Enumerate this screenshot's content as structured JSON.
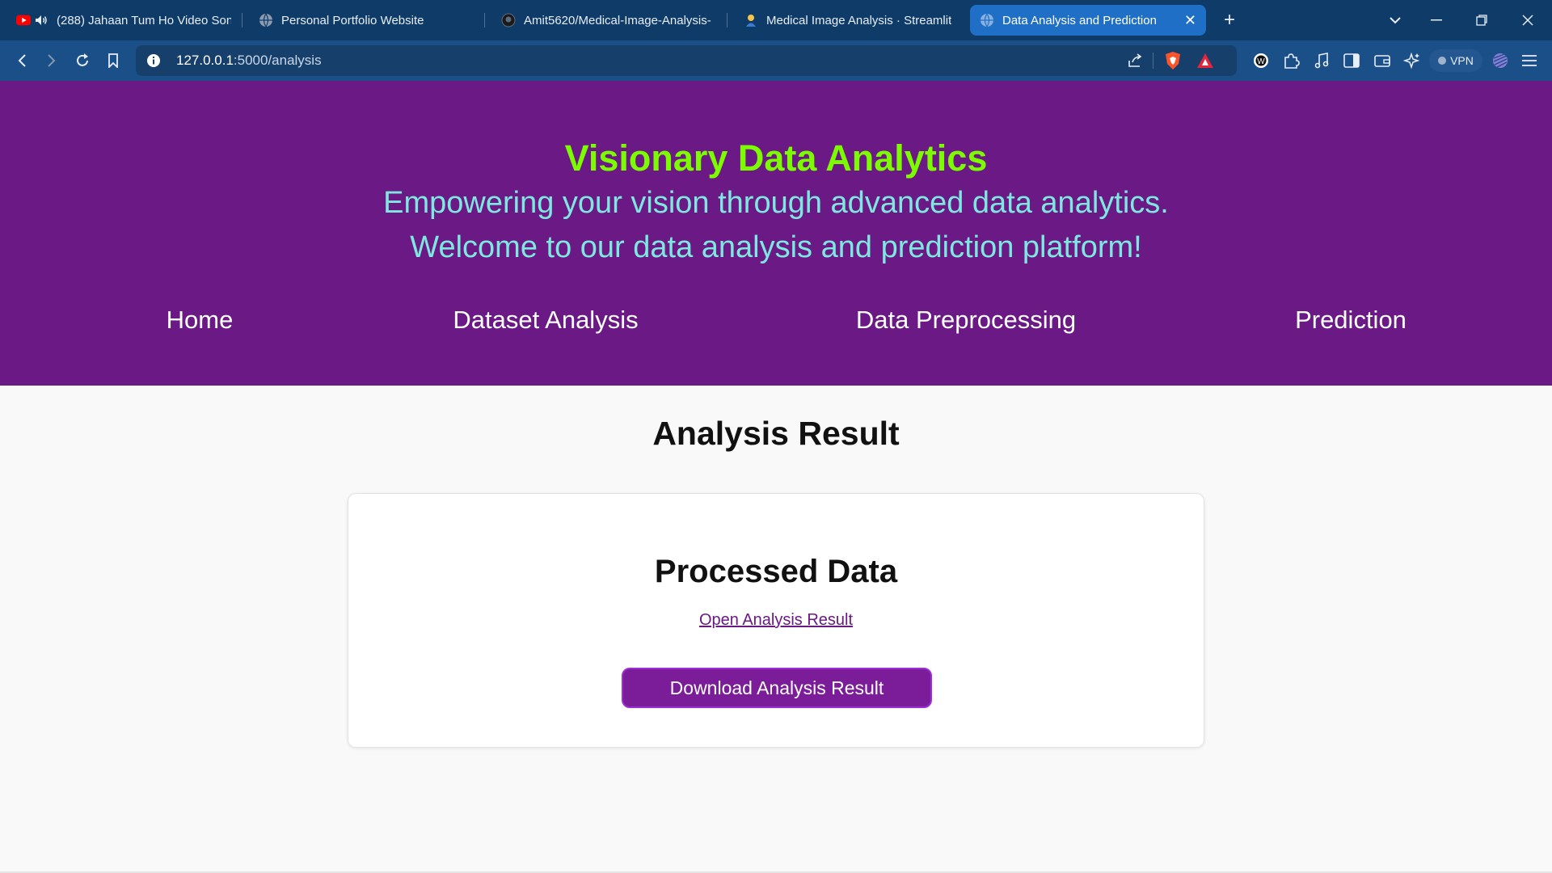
{
  "browser": {
    "tabs": [
      {
        "label": "(288) Jahaan Tum Ho Video Son",
        "icon": "youtube-icon"
      },
      {
        "label": "Personal Portfolio Website",
        "icon": "globe-icon"
      },
      {
        "label": "Amit5620/Medical-Image-Analysis-",
        "icon": "github-icon"
      },
      {
        "label": "Medical Image Analysis · Streamlit",
        "icon": "streamlit-icon"
      },
      {
        "label": "Data Analysis and Prediction",
        "icon": "globe-icon",
        "active": true
      }
    ],
    "url_host": "127.0.0.1",
    "url_path": ":5000/analysis",
    "vpn_label": "VPN",
    "colors": {
      "tabstrip": "#0f3b68",
      "toolbar": "#1b4f87",
      "active_tab": "#1f6fc7"
    }
  },
  "header": {
    "title": "Visionary Data Analytics",
    "subtitle": "Empowering your vision through advanced data analytics.",
    "welcome": "Welcome to our data analysis and prediction platform!",
    "nav": [
      "Home",
      "Dataset Analysis",
      "Data Preprocessing",
      "Prediction"
    ],
    "colors": {
      "background": "#6a1985",
      "title": "#7cfc00",
      "subtitle": "#7ee8e0"
    }
  },
  "main": {
    "heading": "Analysis Result",
    "card": {
      "title": "Processed Data",
      "link_text": "Open Analysis Result",
      "button_label": "Download Analysis Result"
    },
    "colors": {
      "button": "#7b1c98",
      "link": "#6a1985"
    }
  }
}
